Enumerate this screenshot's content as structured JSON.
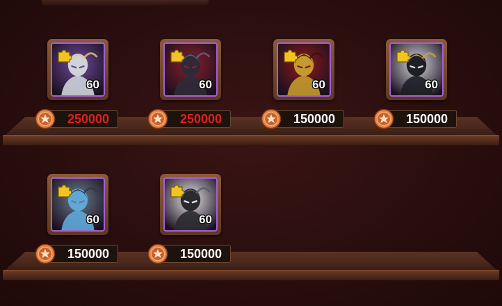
{
  "shop": {
    "rows": [
      {
        "items": [
          {
            "level": "60",
            "price": "250000",
            "affordable": false,
            "hero": "white-winged-helm",
            "palette": [
              "#cfd3da",
              "#6e4a9c",
              "#e8c77a"
            ]
          },
          {
            "level": "60",
            "price": "250000",
            "affordable": false,
            "hero": "dark-armored-knight",
            "palette": [
              "#2f2a38",
              "#8a1f2a",
              "#6a5f78"
            ]
          },
          {
            "level": "60",
            "price": "150000",
            "affordable": true,
            "hero": "golden-masked-warrior",
            "palette": [
              "#c39a2e",
              "#8a1a1a",
              "#3a1010"
            ]
          },
          {
            "level": "60",
            "price": "150000",
            "affordable": true,
            "hero": "dark-horned-beast",
            "palette": [
              "#1e1e26",
              "#d8d8e0",
              "#c9a533"
            ]
          }
        ]
      },
      {
        "items": [
          {
            "level": "60",
            "price": "150000",
            "affordable": true,
            "hero": "blue-flame-undead",
            "palette": [
              "#5fa8d8",
              "#6b7b8a",
              "#2a3a4a"
            ]
          },
          {
            "level": "60",
            "price": "150000",
            "affordable": true,
            "hero": "masked-gunslinger",
            "palette": [
              "#2a2a2e",
              "#e6e6e6",
              "#5a5a60"
            ]
          }
        ]
      }
    ],
    "colors": {
      "price_unaffordable": "#e0201e",
      "price_affordable": "#ffffff",
      "portrait_border": "#a45ed8",
      "coin": "#d8703a"
    },
    "icons": {
      "coin": "gold-coin-icon",
      "puzzle": "puzzle-piece-icon"
    }
  }
}
